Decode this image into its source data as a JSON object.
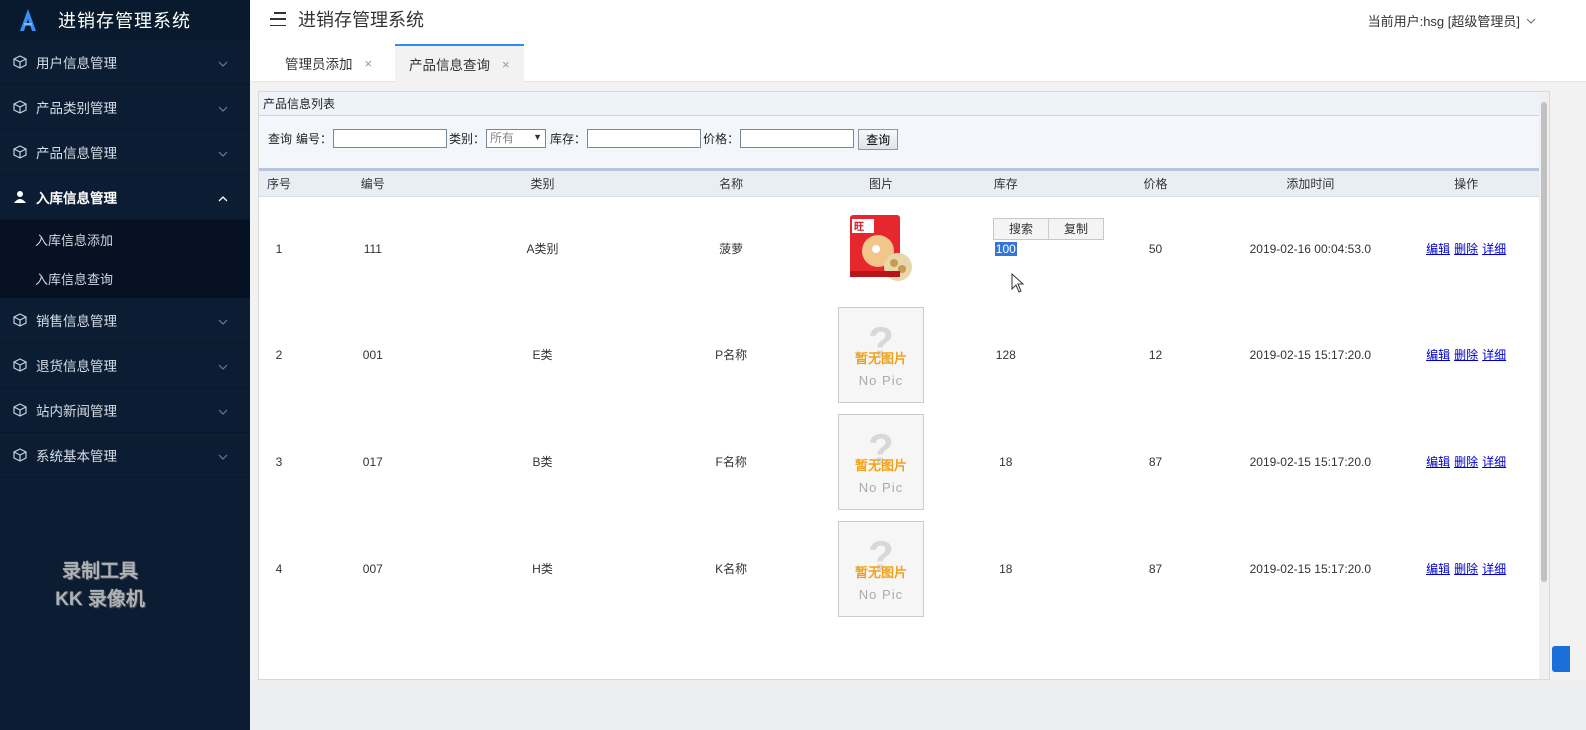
{
  "app": {
    "title": "进销存管理系统",
    "header_title": "进销存管理系统",
    "current_user": "当前用户:hsg [超级管理员]"
  },
  "sidebar": {
    "items": [
      {
        "label": "用户信息管理"
      },
      {
        "label": "产品类别管理"
      },
      {
        "label": "产品信息管理"
      },
      {
        "label": "入库信息管理",
        "active": true
      },
      {
        "label": "销售信息管理"
      },
      {
        "label": "退货信息管理"
      },
      {
        "label": "站内新闻管理"
      },
      {
        "label": "系统基本管理"
      }
    ],
    "submenu": [
      "入库信息添加",
      "入库信息查询"
    ],
    "watermark_line1": "录制工具",
    "watermark_line2": "KK 录像机"
  },
  "tabs": [
    {
      "label": "管理员添加",
      "close": "×"
    },
    {
      "label": "产品信息查询",
      "close": "×",
      "active": true
    }
  ],
  "panel": {
    "title": "产品信息列表"
  },
  "search": {
    "prefix": "查询",
    "id_label": "编号：",
    "category_label": "类别：",
    "category_value": "所有",
    "stock_label": "库存：",
    "price_label": "价格：",
    "button": "查询"
  },
  "table": {
    "headers": [
      "序号",
      "编号",
      "类别",
      "名称",
      "图片",
      "库存",
      "价格",
      "添加时间",
      "操作"
    ],
    "rows": [
      {
        "seq": "1",
        "id": "111",
        "category": "A类别",
        "name": "菠萝",
        "image": "product",
        "stock": "100",
        "price": "50",
        "time": "2019-02-16 00:04:53.0"
      },
      {
        "seq": "2",
        "id": "001",
        "category": "E类",
        "name": "P名称",
        "image": "none",
        "stock": "128",
        "price": "12",
        "time": "2019-02-15 15:17:20.0"
      },
      {
        "seq": "3",
        "id": "017",
        "category": "B类",
        "name": "F名称",
        "image": "none",
        "stock": "18",
        "price": "87",
        "time": "2019-02-15 15:17:20.0"
      },
      {
        "seq": "4",
        "id": "007",
        "category": "H类",
        "name": "K名称",
        "image": "none",
        "stock": "18",
        "price": "87",
        "time": "2019-02-15 15:17:20.0"
      }
    ],
    "actions": [
      "编辑",
      "删除",
      "详细"
    ],
    "no_image_cn": "暂无图片",
    "no_image_en": "No Pic"
  },
  "popup": {
    "search": "搜索",
    "copy": "复制"
  },
  "colors": {
    "sidebar_bg": "#0c1d33",
    "tab_accent": "#2d8cf0",
    "link": "#0000cc",
    "selection": "#3375d6"
  }
}
